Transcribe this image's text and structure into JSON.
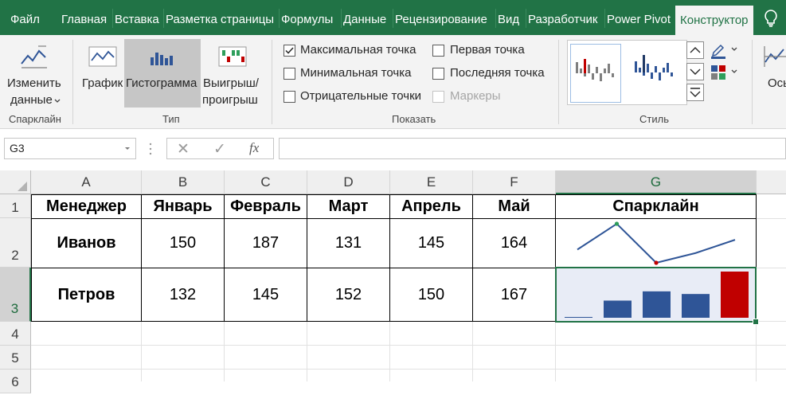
{
  "tabs": {
    "file": "Файл",
    "home": "Главная",
    "insert": "Вставка",
    "page_layout": "Разметка страницы",
    "formulas": "Формулы",
    "data": "Данные",
    "review": "Рецензирование",
    "view": "Вид",
    "developer": "Разработчик",
    "power_pivot": "Power Pivot",
    "design": "Конструктор"
  },
  "ribbon": {
    "edit_data": {
      "line1": "Изменить",
      "line2": "данные",
      "group": "Спарклайн"
    },
    "types": {
      "line": "График",
      "column": "Гистограмма",
      "winloss_line1": "Выигрыш/",
      "winloss_line2": "проигрыш",
      "group": "Тип"
    },
    "show": {
      "high_point": "Максимальная точка",
      "high_point_checked": true,
      "low_point": "Минимальная точка",
      "low_point_checked": false,
      "negative_points": "Отрицательные точки",
      "negative_points_checked": false,
      "first_point": "Первая точка",
      "first_point_checked": false,
      "last_point": "Последняя точка",
      "last_point_checked": false,
      "markers": "Маркеры",
      "markers_checked": false,
      "markers_enabled": false,
      "group": "Показать"
    },
    "style": {
      "group": "Стиль"
    },
    "axis_partial": "Ось"
  },
  "formula_bar": {
    "name_box": "G3",
    "cancel": "✕",
    "enter": "✓",
    "fx": "fx",
    "content": ""
  },
  "grid": {
    "columns": [
      "A",
      "B",
      "C",
      "D",
      "E",
      "F",
      "G"
    ],
    "rows": [
      "1",
      "2",
      "3",
      "4",
      "5",
      "6"
    ],
    "headers": [
      "Менеджер",
      "Январь",
      "Февраль",
      "Март",
      "Апрель",
      "Май",
      "Спарклайн"
    ],
    "data": [
      {
        "name": "Иванов",
        "values": [
          "150",
          "187",
          "131",
          "145",
          "164"
        ]
      },
      {
        "name": "Петров",
        "values": [
          "132",
          "145",
          "152",
          "150",
          "167"
        ]
      }
    ]
  },
  "chart_data": [
    {
      "type": "line",
      "x": [
        "Январь",
        "Февраль",
        "Март",
        "Апрель",
        "Май"
      ],
      "series": [
        {
          "values": [
            150,
            187,
            131,
            145,
            164
          ]
        }
      ],
      "markers": {
        "high": "Февраль",
        "low": "Март"
      }
    },
    {
      "type": "bar",
      "x": [
        "Январь",
        "Февраль",
        "Март",
        "Апрель",
        "Май"
      ],
      "series": [
        {
          "values": [
            132,
            145,
            152,
            150,
            167
          ]
        }
      ],
      "highlight": {
        "high": "Май"
      }
    }
  ],
  "colors": {
    "ribbon_green": "#217346",
    "sparkline": "#2f5597",
    "column": "#2f5597",
    "high_column": "#c00000",
    "high_marker": "#2e9e5b",
    "low_marker": "#c00000"
  }
}
